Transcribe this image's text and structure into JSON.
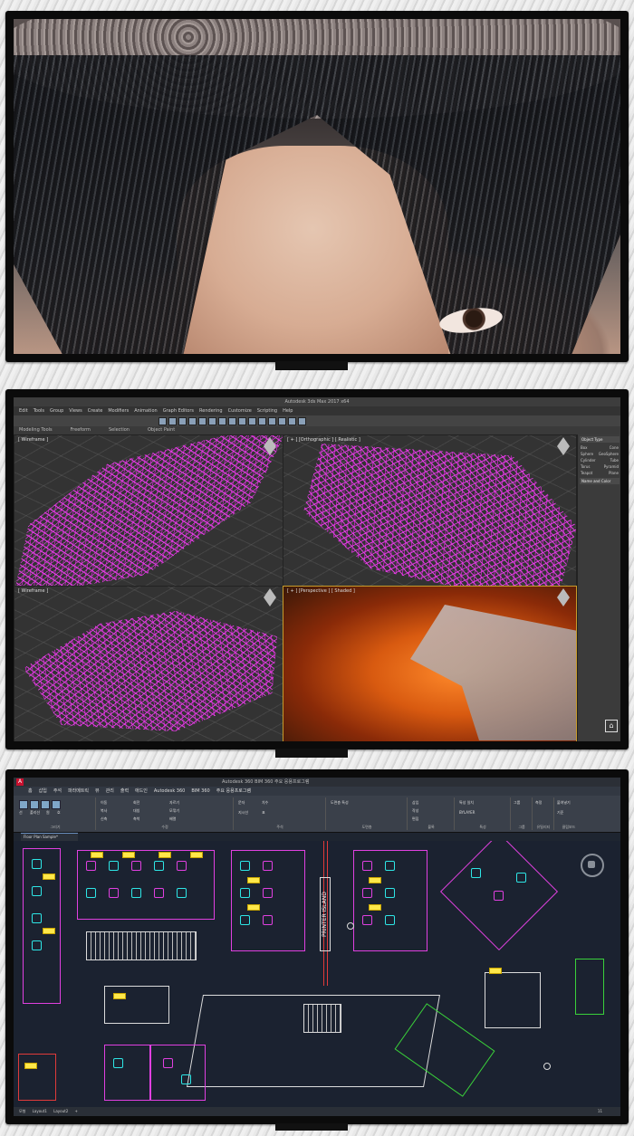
{
  "monitor1": {
    "content": "photo"
  },
  "monitor2": {
    "title": "Autodesk 3ds Max 2017 x64",
    "menu": [
      "Edit",
      "Tools",
      "Group",
      "Views",
      "Create",
      "Modifiers",
      "Animation",
      "Graph Editors",
      "Rendering",
      "Customize",
      "Scripting",
      "Help"
    ],
    "ribbon": [
      "Modeling Tools",
      "Freeform",
      "Selection",
      "Object Paint"
    ],
    "viewports": [
      {
        "label": "[ Wireframe ]"
      },
      {
        "label": "[ + ] [Orthographic ] [ Realistic ]"
      },
      {
        "label": "[ Wireframe ]"
      },
      {
        "label": "[ + ] [Perspective ] [ Shaded ]"
      }
    ],
    "command_panel": {
      "header": "Object Type",
      "rows": [
        [
          "Box",
          "Cone"
        ],
        [
          "Sphere",
          "GeoSphere"
        ],
        [
          "Cylinder",
          "Tube"
        ],
        [
          "Torus",
          "Pyramid"
        ],
        [
          "Teapot",
          "Plane"
        ]
      ],
      "footer": "Name and Color"
    },
    "icon_home": "⌂"
  },
  "monitor3": {
    "logo": "A",
    "title": "Autodesk 360   BIM 360   주요 응용프로그램",
    "tabs": [
      "홈",
      "삽입",
      "주석",
      "파라메트릭",
      "뷰",
      "관리",
      "출력",
      "애드인",
      "Autodesk 360",
      "BIM 360",
      "주요 응용프로그램"
    ],
    "ribbon_groups": [
      {
        "label": "그리기"
      },
      {
        "label": "수정"
      },
      {
        "label": "주석"
      },
      {
        "label": "도면층"
      },
      {
        "label": "블록"
      },
      {
        "label": "특성"
      },
      {
        "label": "그룹"
      },
      {
        "label": "유틸리티"
      },
      {
        "label": "클립보드"
      }
    ],
    "ribbon_texts": [
      "이동",
      "회전",
      "자르기",
      "복사",
      "대칭",
      "모깎기",
      "신축",
      "축척",
      "배열",
      "선",
      "폴리선",
      "원",
      "호",
      "문자",
      "치수",
      "지시선",
      "표",
      "삽입",
      "작성",
      "편집",
      "도면층 특성",
      "특성 일치",
      "BYLAYER",
      "그룹",
      "측정",
      "붙여넣기",
      "기준"
    ],
    "file_tab": "Floor Plan Sample*",
    "drawing_label": "PRINTER ISLAND",
    "status": [
      "모형",
      "Layout1",
      "Layout2",
      "+"
    ],
    "status_right": "11"
  }
}
